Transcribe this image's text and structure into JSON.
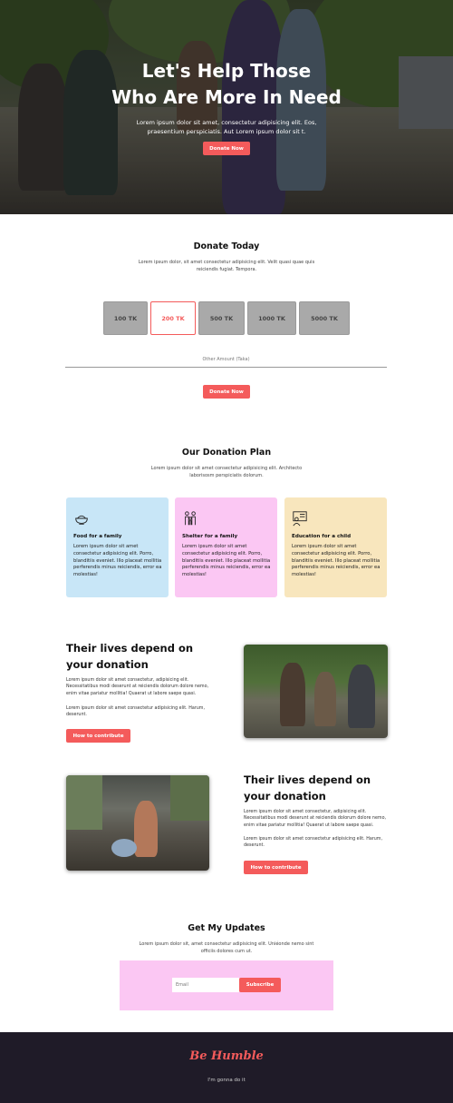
{
  "hero": {
    "title_line1": "Let's Help Those",
    "title_line2": "Who Are More In Need",
    "subtitle": "Lorem ipsum dolor sit amet, consectetur adipisicing elit. Eos, praesentium perspiciatis. Aut Lorem ipsum dolor sit t.",
    "button": "Donate Now"
  },
  "donate": {
    "title": "Donate Today",
    "text": "Lorem ipsum dolor, sit amet consectetur adipisicing elit. Velit quasi quae quis reiciendis fugiat. Tempora.",
    "amounts": [
      "100 TK",
      "200 TK",
      "500 TK",
      "1000 TK",
      "5000 TK"
    ],
    "selected": "200 TK",
    "other_label": "Other Amount (Taka)",
    "button": "Donate Now"
  },
  "plan": {
    "title": "Our Donation Plan",
    "text": "Lorem ipsum dolor sit amet consectetur adipisicing elit. Architecto laborisosm perspiciatis dolorum.",
    "cards": [
      {
        "title": "Food for a family",
        "icon": "food-bowl-icon",
        "body": "Lorem ipsum dolor sit amet consectetur adipisicing elit. Porro, blanditiis eveniet. Illo placeat mollitia perferendis minus reiciendis, error ea molestias!",
        "color": "#c8e6f7"
      },
      {
        "title": "Shelter for a family",
        "icon": "family-icon",
        "body": "Lorem ipsum dolor sit amet consectetur adipisicing elit. Porro, blanditiis eveniet. Illo placeat mollitia perferendis minus reiciendis, error ea molestias!",
        "color": "#fbc7f3"
      },
      {
        "title": "Education for a child",
        "icon": "teacher-icon",
        "body": "Lorem ipsum dolor sit amet consectetur adipisicing elit. Porro, blanditiis eveniet. Illo placeat mollitia perferendis minus reiciendis, error ea molestias!",
        "color": "#f8e6bd"
      }
    ]
  },
  "lives1": {
    "title": "Their lives depend on your donation",
    "para1": "Lorem ipsum dolor sit amet consectetur, adipisicing elit. Necessitatibus modi deserunt at reiciendis dolorum dolore nemo, enim vitae pariatur mollitia! Quaerat ut labore saepe quasi.",
    "para2": "Lorem ipsum dolor sit amet consectetur adipisicing elit. Harum, deserunt.",
    "button": "How to contribute"
  },
  "lives2": {
    "title": "Their lives depend on your donation",
    "para1": "Lorem ipsum dolor sit amet consectetur, adipisicing elit. Necessitatibus modi deserunt at reiciendis dolorum dolore nemo, enim vitae pariatur mollitia! Quaerat ut labore saepe quasi.",
    "para2": "Lorem ipsum dolor sit amet consectetur adipisicing elit. Harum, deserunt.",
    "button": "How to contribute"
  },
  "updates": {
    "title": "Get My Updates",
    "text": "Lorem ipsum dolor sit, amet consectetur adipisicing elit. Uniéonde nemo sint officiis dolores cum ut.",
    "email_placeholder": "Email",
    "button": "Subscribe"
  },
  "footer": {
    "brand": "Be Humble",
    "tagline": "I'm gonna do it"
  },
  "colors": {
    "accent": "#f45b5b",
    "footer_bg": "#1f1b28"
  }
}
